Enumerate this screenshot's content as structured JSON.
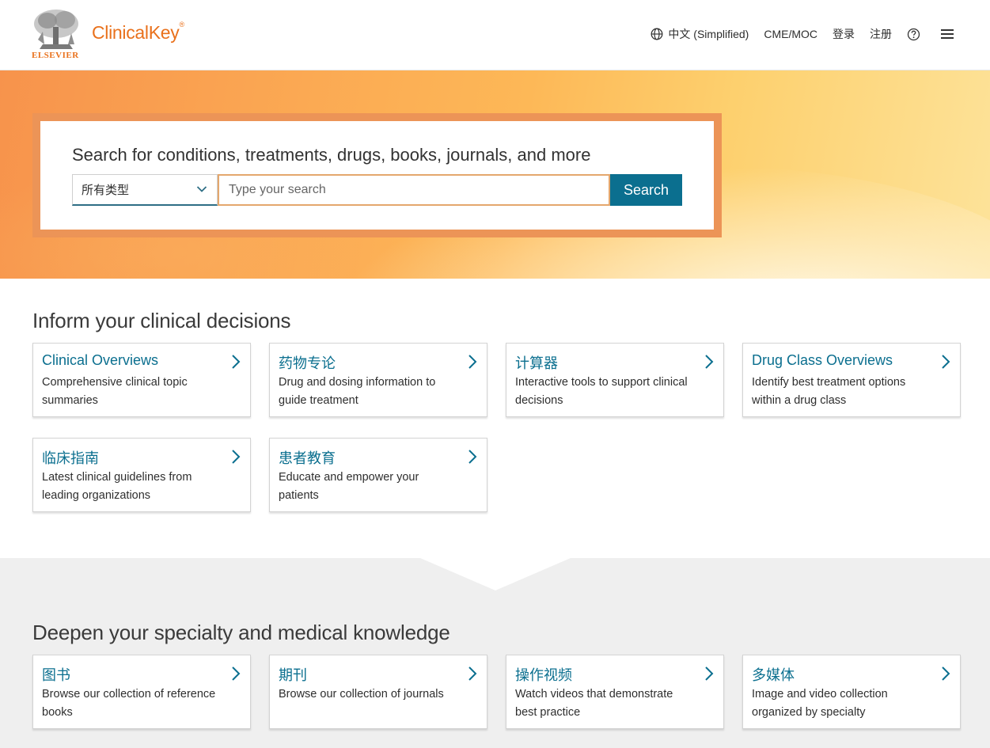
{
  "header": {
    "publisher": "ELSEVIER",
    "brand": "ClinicalKey",
    "brand_mark": "®",
    "nav": {
      "language": "中文 (Simplified)",
      "cme": "CME/MOC",
      "login": "登录",
      "register": "注册"
    },
    "icons": [
      "globe-icon",
      "help-icon",
      "menu-icon"
    ]
  },
  "hero": {
    "search_title": "Search for conditions, treatments, drugs, books, journals, and more",
    "type_select": "所有类型",
    "search_placeholder": "Type your search",
    "search_button": "Search"
  },
  "inform": {
    "title": "Inform your clinical decisions",
    "cards": [
      {
        "title": "Clinical Overviews",
        "desc": "Comprehensive clinical topic summaries"
      },
      {
        "title": "药物专论",
        "desc": "Drug and dosing information to guide treatment"
      },
      {
        "title": "计算器",
        "desc": "Interactive tools to support clinical decisions"
      },
      {
        "title": "Drug Class Overviews",
        "desc": "Identify best treatment options within a drug class"
      },
      {
        "title": "临床指南",
        "desc": "Latest clinical guidelines from leading organizations"
      },
      {
        "title": "患者教育",
        "desc": "Educate and empower your patients"
      }
    ]
  },
  "deepen": {
    "title": "Deepen your specialty and medical knowledge",
    "cards": [
      {
        "title": "图书",
        "desc": "Browse our collection of reference books"
      },
      {
        "title": "期刊",
        "desc": "Browse our collection of journals"
      },
      {
        "title": "操作视频",
        "desc": "Watch videos that demonstrate best practice"
      },
      {
        "title": "多媒体",
        "desc": "Image and video collection organized by specialty"
      }
    ]
  },
  "colors": {
    "brand_orange": "#e9711c",
    "link_teal": "#0b6f8f",
    "search_frame": "#ec9457",
    "band_gray": "#efefef"
  }
}
